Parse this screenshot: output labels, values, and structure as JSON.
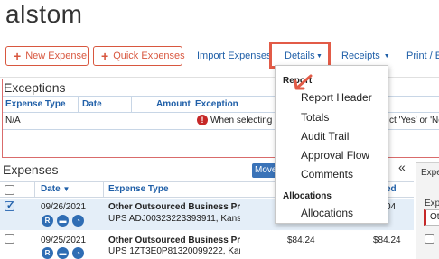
{
  "app": {
    "title": "alstom"
  },
  "toolbar": {
    "new_expense": "New Expense",
    "quick_expenses": "Quick Expenses",
    "import_expenses": "Import Expenses",
    "details": "Details",
    "receipts": "Receipts",
    "print_email": "Print / Em"
  },
  "exceptions": {
    "title": "Exceptions",
    "columns": [
      "Expense Type",
      "Date",
      "Amount",
      "Exception"
    ],
    "row": {
      "type": "N/A",
      "message": "When selecting a",
      "message_tail": "ct 'Yes' or 'No"
    }
  },
  "expenses": {
    "title": "Expenses",
    "move_label": "Move",
    "collapse_glyph": "«",
    "columns": {
      "date": "Date",
      "type": "Expense Type",
      "requested_tail": "ed"
    },
    "rows": [
      {
        "date": "09/26/2021",
        "type": "Other Outsourced Business Pr",
        "detail": "UPS ADJ00323223393911, Kans",
        "amount": "",
        "amount_tail": "04",
        "checked": true
      },
      {
        "date": "09/25/2021",
        "type": "Other Outsourced Business Pr",
        "detail": "UPS 1ZT3E0P81320099222, Kan",
        "amount": "$84.24",
        "amount_tail": "$84.24",
        "checked": false
      }
    ]
  },
  "side_panel": {
    "heading": "Expe",
    "label": "Exp",
    "value": "Ot"
  },
  "details_menu": {
    "report_heading": "Report",
    "report_items": [
      "Report Header",
      "Totals",
      "Audit Trail",
      "Approval Flow",
      "Comments"
    ],
    "allocations_heading": "Allocations",
    "allocation_items": [
      "Allocations"
    ]
  },
  "colors": {
    "accent": "#d8573f",
    "link": "#1f5fa8",
    "highlight": "#e25b47",
    "icon": "#2f6db4"
  }
}
